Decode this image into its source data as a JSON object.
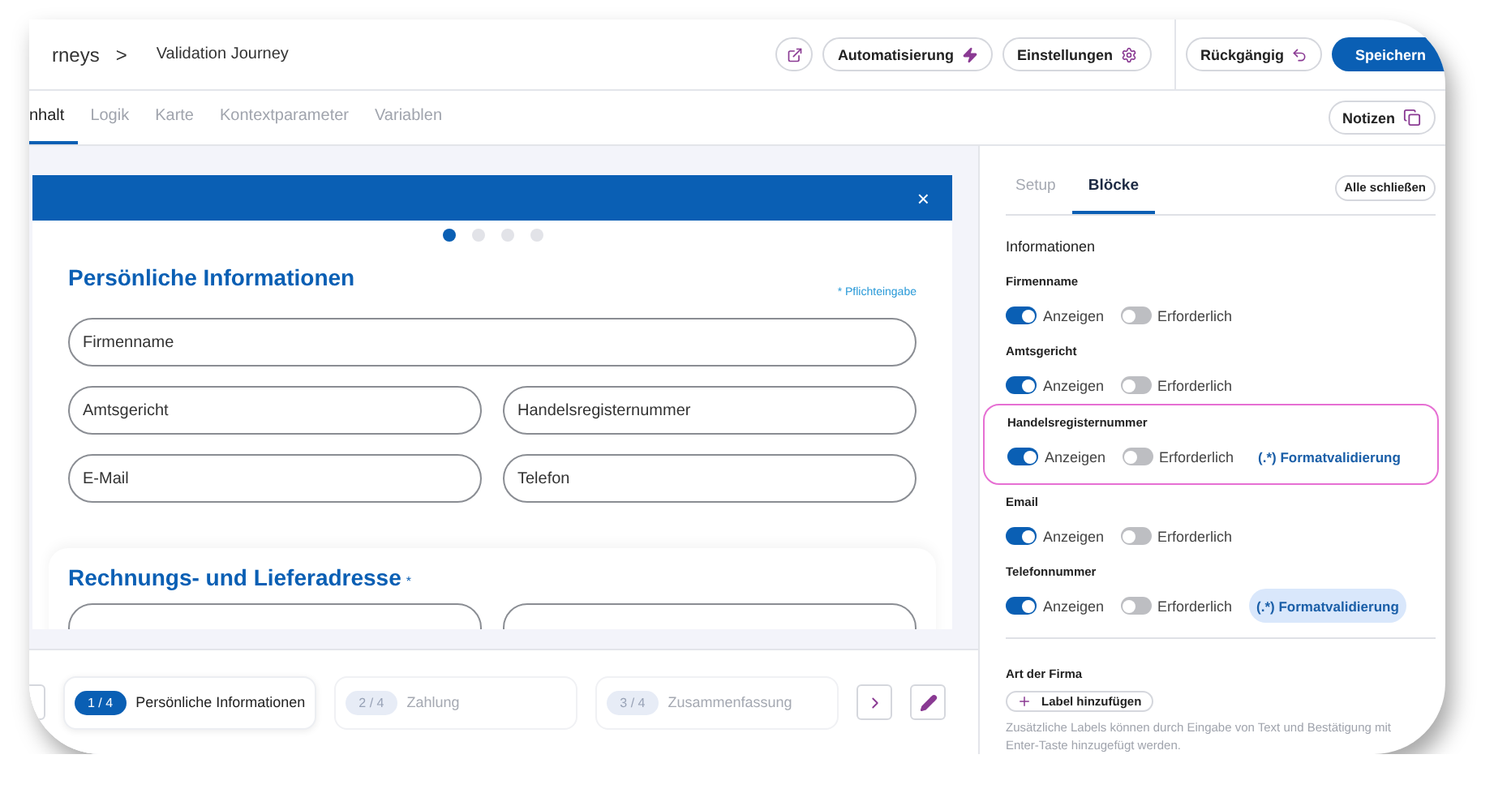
{
  "header": {
    "breadcrumb": "rneys",
    "breadcrumb_separator": ">",
    "title": "Validation Journey",
    "buttons": [
      {
        "kind": "external"
      },
      {
        "kind": "bolt",
        "label": "Automatisierung"
      },
      {
        "kind": "gear",
        "label": "Einstellungen"
      }
    ],
    "undo": "Rückgängig",
    "save": "Speichern"
  },
  "tabs": [
    {
      "label": "nhalt",
      "selected": true
    },
    {
      "label": "Logik",
      "selected": false
    },
    {
      "label": "Karte",
      "selected": false
    },
    {
      "label": "Kontextparameter",
      "selected": false
    },
    {
      "label": "Variablen",
      "selected": false
    }
  ],
  "notes_button": "Notizen",
  "preview": {
    "close": "×",
    "dots": [
      {
        "selected": true
      },
      {
        "selected": false
      },
      {
        "selected": false
      },
      {
        "selected": false
      }
    ],
    "section_title": "Persönliche Informationen",
    "required_note": "* Pflichteingabe",
    "field_rows": [
      [
        {
          "placeholder": "Firmenname"
        }
      ],
      [
        {
          "placeholder": "Amtsgericht"
        },
        {
          "placeholder": "Handelsregisternummer"
        }
      ],
      [
        {
          "placeholder": "E-Mail"
        },
        {
          "placeholder": "Telefon"
        }
      ]
    ],
    "section2_title": "Rechnungs- und Lieferadresse",
    "section2_mark": "*"
  },
  "steps": [
    {
      "badge": "1 / 4",
      "label": "Persönliche Informationen",
      "selected": true
    },
    {
      "badge": "2 / 4",
      "label": "Zahlung",
      "selected": false
    },
    {
      "badge": "3 / 4",
      "label": "Zusammenfassung",
      "selected": false
    }
  ],
  "panel": {
    "tabs": [
      {
        "label": "Setup",
        "selected": false
      },
      {
        "label": "Blöcke",
        "selected": true
      }
    ],
    "collapse_all": "Alle schließen",
    "group_title": "Informationen",
    "fields": [
      {
        "name": "Firmenname",
        "highlighted": false,
        "show": {
          "label": "Anzeigen",
          "on": true
        },
        "required": {
          "label": "Erforderlich",
          "on": false
        }
      },
      {
        "name": "Amtsgericht",
        "highlighted": false,
        "show": {
          "label": "Anzeigen",
          "on": true
        },
        "required": {
          "label": "Erforderlich",
          "on": false
        }
      },
      {
        "name": "Handelsregisternummer",
        "highlighted": true,
        "show": {
          "label": "Anzeigen",
          "on": true
        },
        "required": {
          "label": "Erforderlich",
          "on": false
        },
        "format_validation": {
          "label": "(.*) Formatvalidierung",
          "active": false
        }
      },
      {
        "name": "Email",
        "highlighted": false,
        "show": {
          "label": "Anzeigen",
          "on": true
        },
        "required": {
          "label": "Erforderlich",
          "on": false
        }
      },
      {
        "name": "Telefonnummer",
        "highlighted": false,
        "show": {
          "label": "Anzeigen",
          "on": true
        },
        "required": {
          "label": "Erforderlich",
          "on": false
        },
        "format_validation": {
          "label": "(.*) Formatvalidierung",
          "active": true
        }
      }
    ],
    "company_type": {
      "title": "Art der Firma",
      "add_label": "Label hinzufügen",
      "hint": "Zusätzliche Labels können durch Eingabe von Text und Bestätigung mit Enter-Taste hinzugefügt werden."
    }
  }
}
